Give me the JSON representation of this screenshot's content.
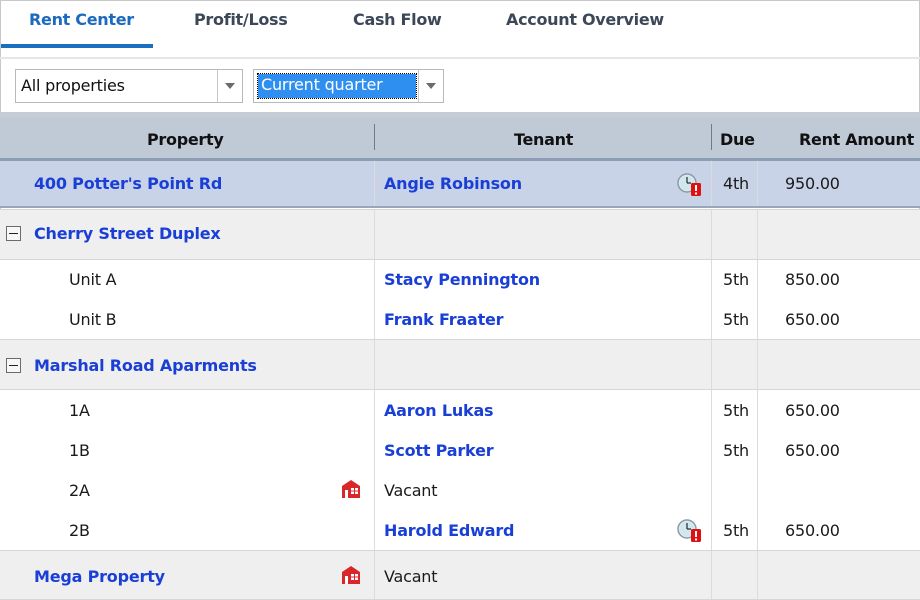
{
  "tabs": [
    {
      "label": "Rent Center",
      "active": true
    },
    {
      "label": "Profit/Loss",
      "active": false
    },
    {
      "label": "Cash Flow",
      "active": false
    },
    {
      "label": "Account Overview",
      "active": false
    }
  ],
  "filters": {
    "property_filter": {
      "selected": "All properties"
    },
    "period_filter": {
      "selected": "Current quarter"
    }
  },
  "grid": {
    "columns": [
      "Property",
      "Tenant",
      "Due",
      "Rent Amount"
    ],
    "rows": [
      {
        "type": "property",
        "property": "400 Potter's Point Rd",
        "tenant": "Angie Robinson",
        "tenant_icon": "late-payment-icon",
        "due": "4th",
        "rent": "950.00",
        "selected": true
      },
      {
        "type": "group",
        "property": "Cherry Street Duplex",
        "expanded": true
      },
      {
        "type": "unit",
        "property": "Unit A",
        "tenant": "Stacy Pennington",
        "due": "5th",
        "rent": "850.00"
      },
      {
        "type": "unit",
        "property": "Unit B",
        "tenant": "Frank Fraater",
        "due": "5th",
        "rent": "650.00"
      },
      {
        "type": "group",
        "property": "Marshal Road Aparments",
        "expanded": true
      },
      {
        "type": "unit",
        "property": "1A",
        "tenant": "Aaron Lukas",
        "due": "5th",
        "rent": "650.00"
      },
      {
        "type": "unit",
        "property": "1B",
        "tenant": "Scott Parker",
        "due": "5th",
        "rent": "650.00"
      },
      {
        "type": "unit",
        "property": "2A",
        "property_icon": "vacant-icon",
        "tenant": "Vacant",
        "due": "",
        "rent": ""
      },
      {
        "type": "unit",
        "property": "2B",
        "tenant": "Harold Edward",
        "tenant_icon": "late-payment-icon",
        "due": "5th",
        "rent": "650.00"
      },
      {
        "type": "group-property",
        "property": "Mega Property",
        "property_icon": "vacant-icon",
        "tenant": "Vacant"
      }
    ]
  },
  "colors": {
    "accent": "#1b6fbf",
    "link": "#1a3fd6",
    "selected_row": "#c9d3e8",
    "header_bg": "#c0c9d6",
    "group_row": "#efefef",
    "alert_red": "#e01010",
    "selection_highlight": "#2f8ff0"
  }
}
